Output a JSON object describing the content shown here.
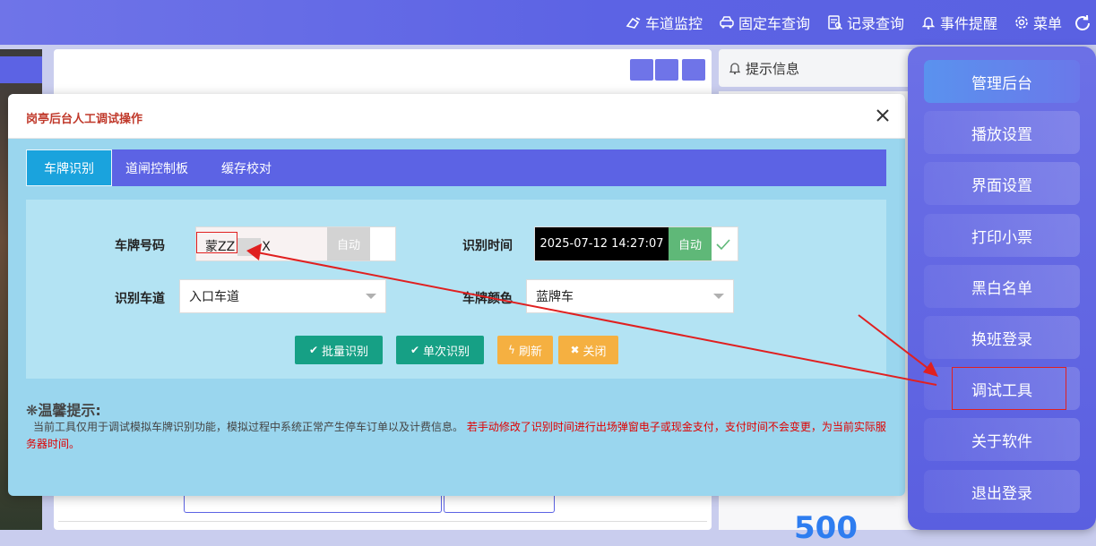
{
  "nav": {
    "items": [
      {
        "label": "车道监控",
        "icon": "lane-monitor-icon"
      },
      {
        "label": "固定车查询",
        "icon": "car-icon"
      },
      {
        "label": "记录查询",
        "icon": "record-search-icon"
      },
      {
        "label": "事件提醒",
        "icon": "bell-icon"
      },
      {
        "label": "菜单",
        "icon": "gear-icon"
      }
    ],
    "refresh_icon": "refresh-icon"
  },
  "background": {
    "info_label": "提示信息",
    "count": "500"
  },
  "modal": {
    "title": "岗亭后台人工调试操作",
    "tabs": [
      "车牌识别",
      "道闸控制板",
      "缓存校对"
    ],
    "active_tab": 0,
    "form": {
      "plate_label": "车牌号码",
      "plate_value": "蒙ZZ",
      "plate_suffix": "X",
      "plate_auto": "自动",
      "time_label": "识别时间",
      "time_value": "2025-07-12 14:27:07",
      "time_auto": "自动",
      "lane_label": "识别车道",
      "lane_value": "入口车道",
      "color_label": "车牌颜色",
      "color_value": "蓝牌车"
    },
    "buttons": {
      "batch": "批量识别",
      "single": "单次识别",
      "refresh": "刷新",
      "close": "关闭"
    },
    "tips": {
      "title": "❋温馨提示:",
      "text": "当前工具仅用于调试模拟车牌识别功能，模拟过程中系统正常产生停车订单以及计费信息。",
      "warning": "若手动修改了识别时间进行出场弹窗电子或现金支付，支付时间不会变更，为当前实际服务器时间。"
    }
  },
  "menu": {
    "items": [
      "管理后台",
      "播放设置",
      "界面设置",
      "打印小票",
      "黑白名单",
      "换班登录",
      "调试工具",
      "关于软件",
      "退出登录"
    ],
    "highlighted": "调试工具"
  },
  "colors": {
    "primary": "#5c63e4",
    "tab_active": "#1aa3dd",
    "modal_bg": "#9ad6ee",
    "green_button": "#16a085",
    "orange_button": "#f5b041",
    "annotation_red": "#e02020"
  }
}
